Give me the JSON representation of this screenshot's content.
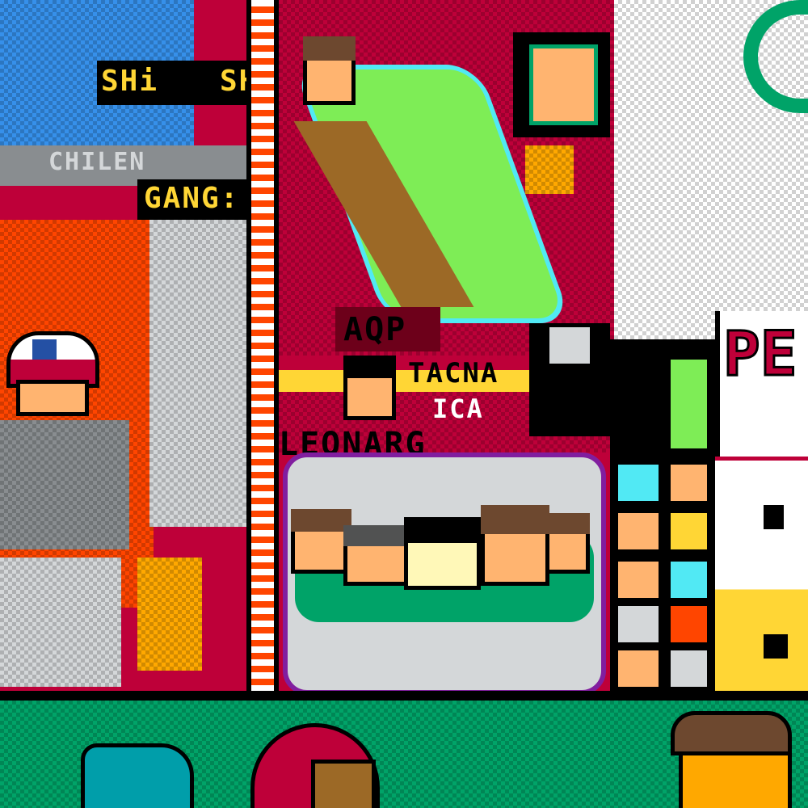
{
  "canvas": {
    "labels": {
      "shi_left": "SHi",
      "shi_right": "SHi",
      "chilen": "CHILEN",
      "gang": "GANG:",
      "aqp": "AQP",
      "tacna": "TACNA",
      "ica": "ICA",
      "leonarg": "LEONARG",
      "pe": "PE"
    },
    "colors": {
      "red": "#be0039",
      "orange": "#ff4500",
      "green": "#00a368",
      "light_green": "#7eed56",
      "yellow": "#ffd635",
      "gray": "#898d90",
      "white": "#ffffff",
      "black": "#000000",
      "blue": "#3690ea",
      "purple": "#811e9f",
      "brown": "#9c6926"
    }
  }
}
